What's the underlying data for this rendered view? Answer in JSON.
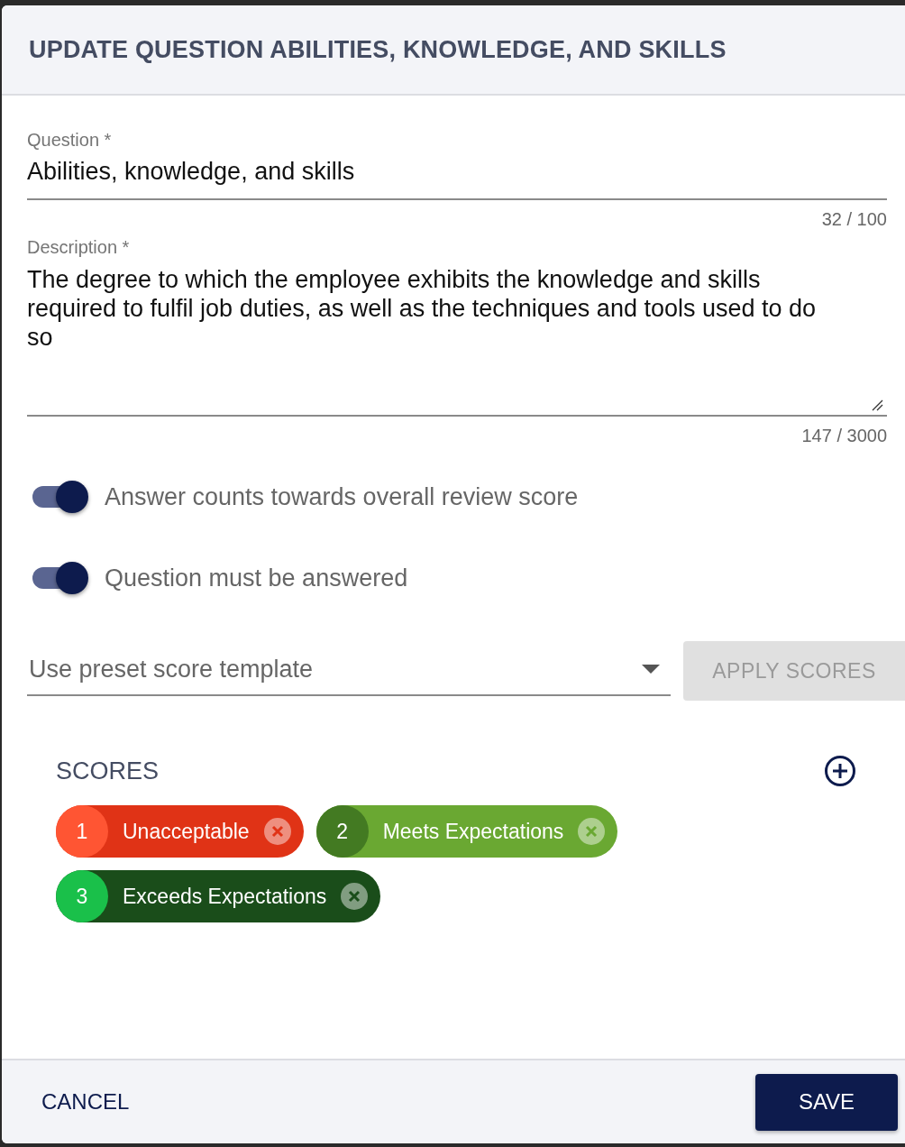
{
  "dialog": {
    "title": "UPDATE QUESTION ABILITIES, KNOWLEDGE, AND SKILLS"
  },
  "question": {
    "label": "Question *",
    "value": "Abilities, knowledge, and skills",
    "counter": "32 / 100"
  },
  "description": {
    "label": "Description *",
    "value": "The degree to which the employee exhibits the knowledge and skills required to fulfil job duties, as well as the techniques and tools used to do so",
    "counter": "147 / 3000"
  },
  "toggles": [
    {
      "label": "Answer counts towards overall review score",
      "on": true
    },
    {
      "label": "Question must be answered",
      "on": true
    }
  ],
  "template_select": {
    "placeholder": "Use preset score template"
  },
  "apply_button": {
    "label": "APPLY SCORES",
    "disabled": true
  },
  "scores": {
    "heading": "SCORES",
    "items": [
      {
        "number": {
          "text": "1",
          "color": "#ff5533"
        },
        "label": "Unacceptable",
        "color": "#e03316"
      },
      {
        "number": {
          "text": "2",
          "color": "#437a22"
        },
        "label": "Meets Expectations",
        "color": "#6aa832"
      },
      {
        "number": {
          "text": "3",
          "color": "#1ac04a"
        },
        "label": "Exceeds Expectations",
        "color": "#1a4d1a"
      }
    ]
  },
  "footer": {
    "cancel": "CANCEL",
    "save": "SAVE"
  }
}
